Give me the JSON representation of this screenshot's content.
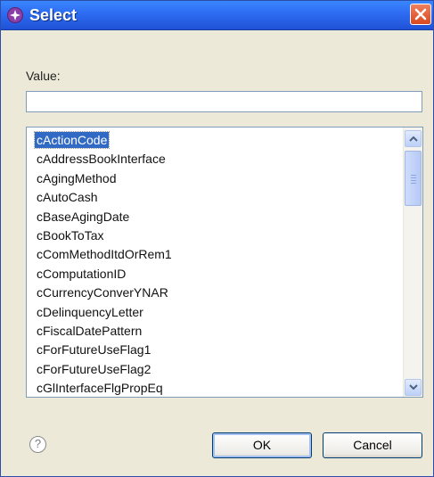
{
  "window": {
    "title": "Select"
  },
  "form": {
    "value_label": "Value:",
    "value_input": ""
  },
  "list": {
    "items": [
      "cActionCode",
      "cAddressBookInterface",
      "cAgingMethod",
      "cAutoCash",
      "cBaseAgingDate",
      "cBookToTax",
      "cComMethodItdOrRem1",
      "cComputationID",
      "cCurrencyConverYNAR",
      "cDelinquencyLetter",
      "cFiscalDatePattern",
      "cForFutureUseFlag1",
      "cForFutureUseFlag2",
      "cGlInterfaceFlgPropEq"
    ],
    "selected_index": 0
  },
  "buttons": {
    "ok_label": "OK",
    "cancel_label": "Cancel",
    "help_glyph": "?"
  },
  "colors": {
    "titlebar": "#2d6bf0",
    "selection": "#316ac5",
    "close": "#d9481f"
  },
  "icons": {
    "title": "app-icon",
    "close": "close-icon",
    "help": "help-icon",
    "scroll_up": "chevron-up-icon",
    "scroll_down": "chevron-down-icon"
  }
}
